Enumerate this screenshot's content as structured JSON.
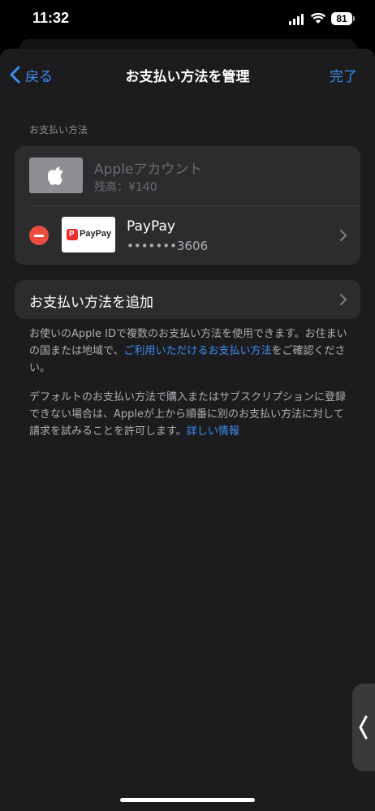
{
  "status_bar": {
    "time": "11:32",
    "battery": "81",
    "icons": [
      "signal-icon",
      "wifi-icon",
      "battery-icon"
    ]
  },
  "nav": {
    "back_label": "戻る",
    "title": "お支払い方法を管理",
    "done_label": "完了"
  },
  "section_header": "お支払い方法",
  "methods": [
    {
      "name": "Appleアカウント",
      "detail": "残高：¥140",
      "icon": "apple-logo-icon"
    },
    {
      "name": "PayPay",
      "detail": "•••••••3606",
      "logo_text": "PayPay",
      "logo_mark": "P",
      "icon": "chevron-right-icon"
    }
  ],
  "add_method_label": "お支払い方法を追加",
  "footnote1": {
    "text_before": "お使いのApple IDで複数のお支払い方法を使用できます。お住まいの国または地域で、",
    "link": "ご利用いただけるお支払い方法",
    "text_after": "をご確認ください。"
  },
  "footnote2": {
    "text_before": "デフォルトのお支払い方法で購入またはサブスクリプションに登録できない場合は、Appleが上から順番に別のお支払い方法に対して請求を試みることを許可します。",
    "link": "詳しい情報"
  },
  "colors": {
    "accent": "#3b8df5",
    "destructive": "#eb4d3d",
    "background": "#1c1c1e",
    "card": "#2c2c2e",
    "paypay_red": "#f02d2d"
  }
}
